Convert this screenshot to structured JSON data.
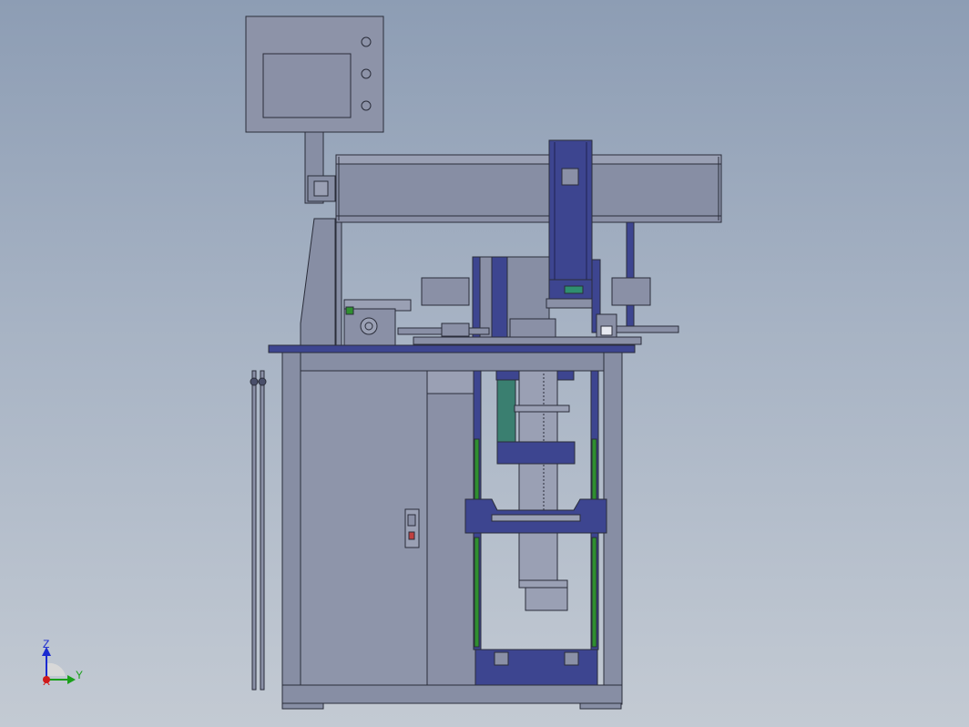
{
  "triad": {
    "z_label": "Z",
    "y_label": "Y",
    "x_label": "X"
  },
  "colors": {
    "background_top": "#8d9db4",
    "background_bottom": "#c3cad3",
    "frame": "#878ea4",
    "outline": "#2a2d3a",
    "navy": "#3d4590",
    "green_rail": "#2f8f2f",
    "teal_block": "#3a7f70",
    "panel": "#8e95aa"
  }
}
